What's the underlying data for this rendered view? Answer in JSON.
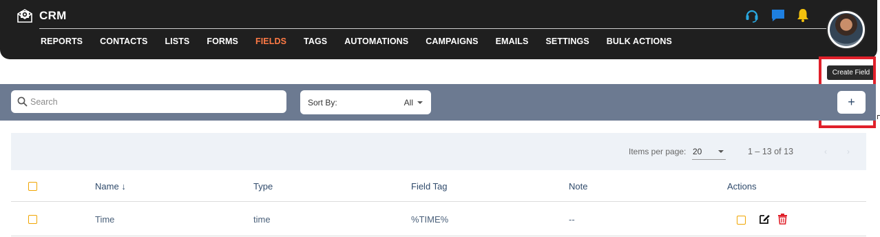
{
  "app": {
    "brand": "CRM"
  },
  "nav": [
    {
      "label": "REPORTS",
      "active": false
    },
    {
      "label": "CONTACTS",
      "active": false
    },
    {
      "label": "LISTS",
      "active": false
    },
    {
      "label": "FORMS",
      "active": false
    },
    {
      "label": "FIELDS",
      "active": true
    },
    {
      "label": "TAGS",
      "active": false
    },
    {
      "label": "AUTOMATIONS",
      "active": false
    },
    {
      "label": "CAMPAIGNS",
      "active": false
    },
    {
      "label": "EMAILS",
      "active": false
    },
    {
      "label": "SETTINGS",
      "active": false
    },
    {
      "label": "BULK ACTIONS",
      "active": false
    }
  ],
  "header_icons": [
    "headset-icon",
    "chat-icon",
    "bell-icon"
  ],
  "colors": {
    "header_bg": "#1f1f1f",
    "active_nav": "#ff7a45",
    "toolbar_bg": "#6c7a91",
    "checkbox": "#f0a500",
    "delete": "#e0202a"
  },
  "tooltip": {
    "text": "Create Field"
  },
  "toolbar": {
    "search_placeholder": "Search",
    "sort_label": "Sort By:",
    "sort_value": "All",
    "add_label": "+"
  },
  "pagination": {
    "items_per_page_label": "Items per page:",
    "items_per_page_value": "20",
    "range": "1 – 13 of 13"
  },
  "table": {
    "columns": [
      "Name",
      "Type",
      "Field Tag",
      "Note",
      "Actions"
    ],
    "sort_indicator": "↓",
    "rows": [
      {
        "name": "Time",
        "type": "time",
        "tag": "%TIME%",
        "note": "--"
      }
    ]
  }
}
